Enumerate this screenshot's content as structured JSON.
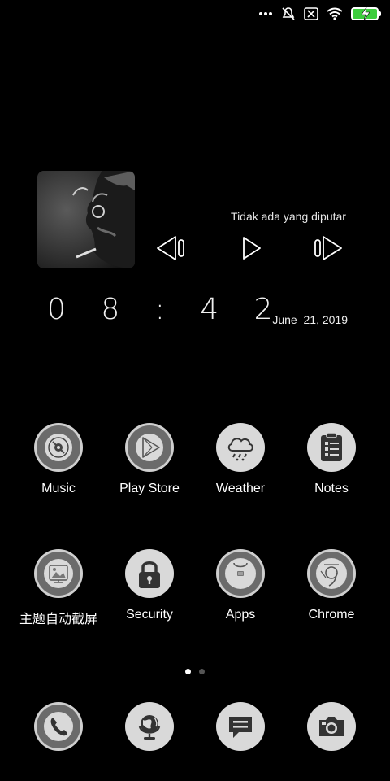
{
  "status_bar": {
    "icons": [
      "more-dots-icon",
      "mute-icon",
      "sim-off-icon",
      "wifi-icon",
      "battery-charging-icon"
    ],
    "battery_color": "#3ccd3c"
  },
  "music_widget": {
    "status": "Tidak ada yang diputar",
    "controls": [
      "previous-icon",
      "play-icon",
      "next-icon"
    ]
  },
  "clock_widget": {
    "time": "0 8 : 4 2",
    "date": "June  21, 2019"
  },
  "apps": [
    {
      "label": "Music",
      "icon": "disc-icon"
    },
    {
      "label": "Play Store",
      "icon": "play-store-icon"
    },
    {
      "label": "Weather",
      "icon": "weather-cloud-icon"
    },
    {
      "label": "Notes",
      "icon": "notes-clipboard-icon"
    },
    {
      "label": "主题自动截屏",
      "icon": "theme-screenshot-icon"
    },
    {
      "label": "Security",
      "icon": "lock-icon"
    },
    {
      "label": "Apps",
      "icon": "apps-icon"
    },
    {
      "label": "Chrome",
      "icon": "chrome-icon"
    }
  ],
  "page_indicator": {
    "pages": 2,
    "active_page": 1
  },
  "dock": [
    {
      "icon": "phone-icon"
    },
    {
      "icon": "browser-globe-icon"
    },
    {
      "icon": "messages-icon"
    },
    {
      "icon": "camera-icon"
    }
  ],
  "colors": {
    "background": "#000000",
    "icon_fill": "#d9d9d9",
    "icon_dark": "#333333"
  }
}
